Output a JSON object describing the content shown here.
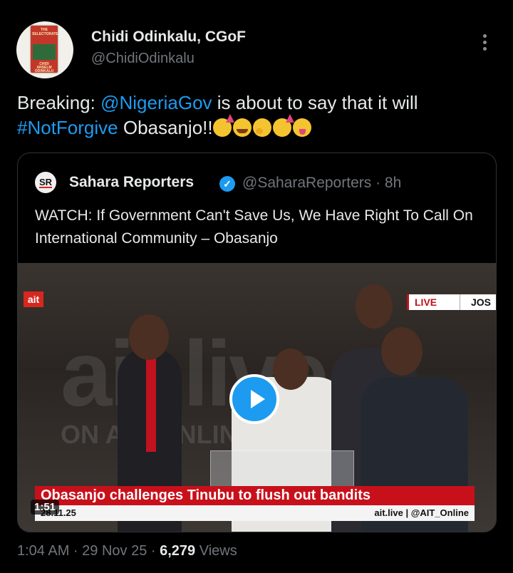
{
  "author": {
    "name": "Chidi Odinkalu, CGoF",
    "handle": "@ChidiOdinkalu",
    "avatar_book": {
      "title_line1": "THE",
      "title_line2": "SELECTORATE",
      "author_line": "CHIDI ANSELM ODINKALU"
    }
  },
  "tweet": {
    "prefix": "Breaking: ",
    "mention": "@NigeriaGov",
    "middle": " is about to say that it will",
    "hashtag": "#NotForgive",
    "suffix": " Obasanjo!!",
    "emojis": [
      "partying-face",
      "face-with-tears-of-joy",
      "hugging-face",
      "partying-face",
      "winking-face-with-tongue"
    ]
  },
  "quote": {
    "logo": "SR",
    "name": "Sahara Reporters",
    "handle_time": "@SaharaReporters · 8h",
    "text": "WATCH: If Government Can't Save Us, We Have Right To Call On International Community – Obasanjo",
    "video": {
      "channel_logo": "ait",
      "live_label": "LIVE",
      "location": "JOS",
      "watermark": "ait.live",
      "watermark2": "ON AIT, ONLINE",
      "headline": "Obasanjo challenges Tinubu to flush out bandits",
      "date": "28.11.25",
      "credit": "ait.live | @AIT_Online",
      "duration": "1:51"
    }
  },
  "meta": {
    "time_date": "1:04 AM · 29 Nov 25 · ",
    "views_count": "6,279",
    "views_label": " Views"
  }
}
